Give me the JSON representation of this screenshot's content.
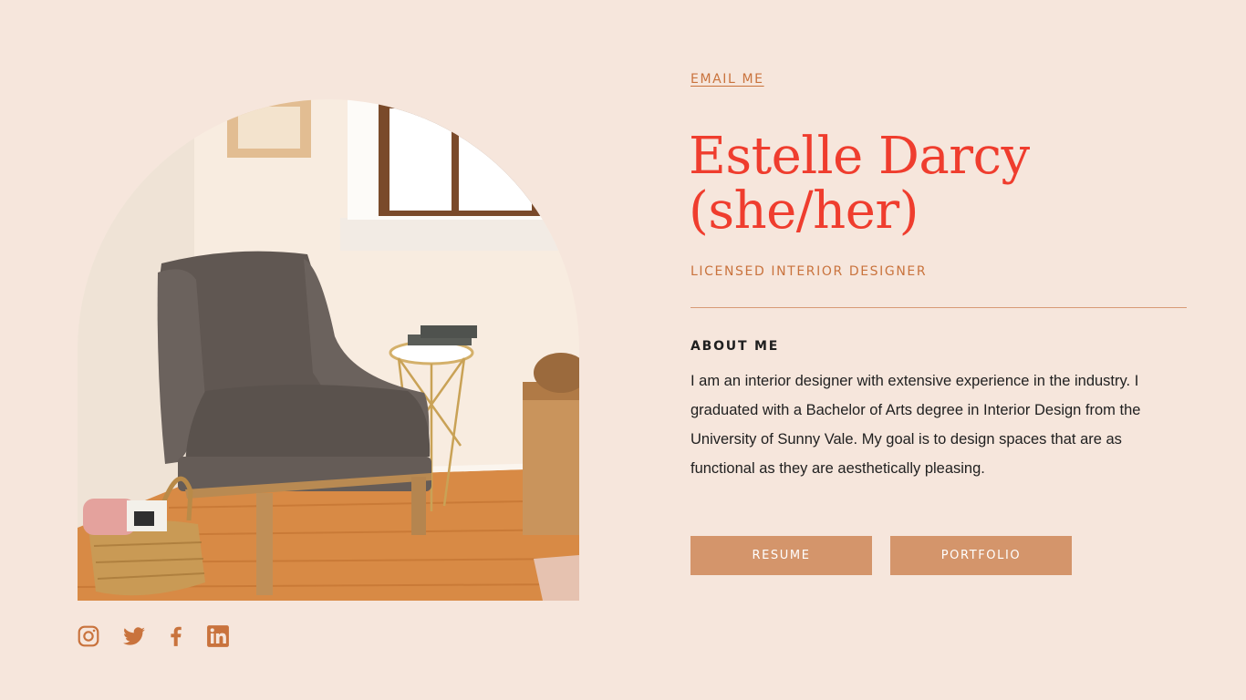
{
  "profile": {
    "email_link": "EMAIL ME",
    "name_line1": "Estelle Darcy",
    "name_line2": "(she/her)",
    "title": "LICENSED INTERIOR DESIGNER"
  },
  "about": {
    "heading": "ABOUT ME",
    "body": "I am an interior designer with extensive experience in the industry. I graduated with a Bachelor of Arts degree in Interior Design from the University of Sunny Vale. My goal is to design spaces that are as functional as they are aesthetically pleasing."
  },
  "buttons": {
    "resume": "RESUME",
    "portfolio": "PORTFOLIO"
  },
  "socials": [
    {
      "icon": "instagram-icon"
    },
    {
      "icon": "twitter-icon"
    },
    {
      "icon": "facebook-icon"
    },
    {
      "icon": "linkedin-icon"
    }
  ],
  "colors": {
    "background": "#f6e6dc",
    "accent_red": "#ef3d2e",
    "accent_orange": "#c9733d",
    "button": "#d4956b"
  }
}
